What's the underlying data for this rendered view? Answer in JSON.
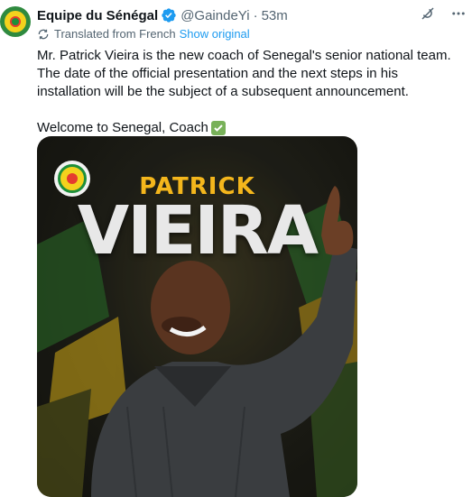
{
  "author": {
    "name": "Equipe du Sénégal",
    "handle": "@GaindeYi",
    "separator": "·",
    "time": "53m",
    "verified": true
  },
  "translation": {
    "note": "Translated from French",
    "show_original": "Show original"
  },
  "tweet": {
    "paragraph1": "Mr. Patrick Vieira is the new coach of Senegal's senior national team. The date of the official presentation and the next steps in his installation will be the subject of a subsequent announcement.",
    "paragraph2": "Welcome to Senegal, Coach"
  },
  "media": {
    "first_name": "PATRICK",
    "last_name": "VIEIRA"
  },
  "icons": {
    "verified": "verified-badge-icon",
    "grok": "grok-icon",
    "more": "more-icon",
    "translate": "translate-icon",
    "check": "check-mark-emoji"
  },
  "colors": {
    "accent": "#1d9bf0",
    "muted": "#536471",
    "first_name": "#f4b61c",
    "last_name": "#e8e8e8",
    "check": "#78b159"
  }
}
